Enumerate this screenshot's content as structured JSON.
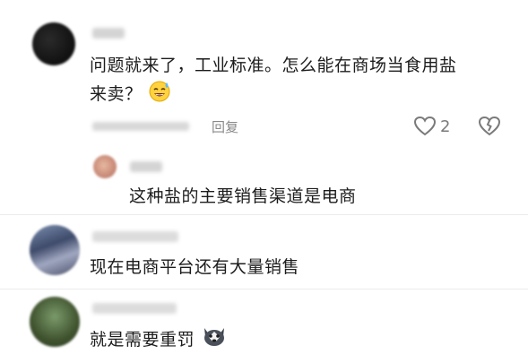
{
  "comments": [
    {
      "text_line1": "问题就来了，工业标准。怎么能在商场当食用盐",
      "text_line2": "来卖？",
      "emoji_icon": "sweat-smile-emoji",
      "reply_label": "回复",
      "like_count": "2",
      "reply": {
        "text": "这种盐的主要销售渠道是电商"
      }
    },
    {
      "text": "现在电商平台还有大量销售"
    },
    {
      "text": "就是需要重罚",
      "emoji_icon": "husky-dog-emoji"
    }
  ],
  "colors": {
    "text": "#1c1c1c",
    "meta": "#8a8a8a",
    "divider": "#ececec"
  }
}
